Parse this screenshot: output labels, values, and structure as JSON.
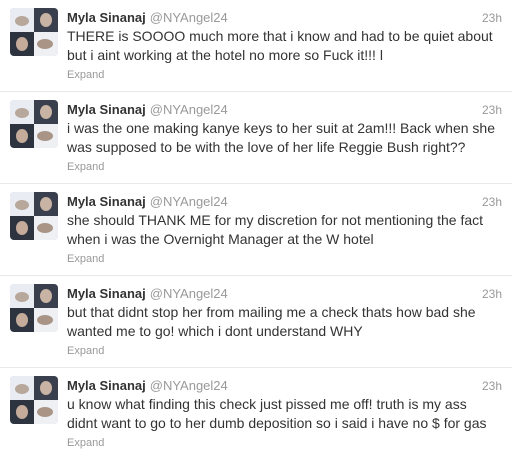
{
  "colors": {
    "name": "#333333",
    "meta": "#999999",
    "divider": "#e8e8e8",
    "background": "#ffffff"
  },
  "tweets": [
    {
      "name": "Myla Sinanaj",
      "handle": "@NYAngel24",
      "time": "23h",
      "lines": [
        "THERE is SOOOO much more that i know and had to be quiet about",
        "but i aint working at the hotel no more so Fuck it!!! l"
      ],
      "expand": "Expand",
      "avatar_icon": "profile-photo-icon"
    },
    {
      "name": "Myla Sinanaj",
      "handle": "@NYAngel24",
      "time": "23h",
      "lines": [
        "i was the one making kanye keys to her suit at 2am!!! Back when she",
        "was supposed to be with the love of her life Reggie Bush right??"
      ],
      "expand": "Expand",
      "avatar_icon": "profile-photo-icon"
    },
    {
      "name": "Myla Sinanaj",
      "handle": "@NYAngel24",
      "time": "23h",
      "lines": [
        "she should THANK ME for my discretion for not mentioning the fact",
        "when i was the Overnight Manager at the W hotel"
      ],
      "expand": "Expand",
      "avatar_icon": "profile-photo-icon"
    },
    {
      "name": "Myla Sinanaj",
      "handle": "@NYAngel24",
      "time": "23h",
      "lines": [
        "but that didnt stop her from mailing me a check thats how bad she",
        "wanted me to go! which i dont understand WHY"
      ],
      "expand": "Expand",
      "avatar_icon": "profile-photo-icon"
    },
    {
      "name": "Myla Sinanaj",
      "handle": "@NYAngel24",
      "time": "23h",
      "lines": [
        "u know what finding this check just pissed me off! truth is my ass",
        "didnt want to go to her dumb deposition so i said i have no $ for gas"
      ],
      "expand": "Expand",
      "avatar_icon": "profile-photo-icon"
    }
  ]
}
